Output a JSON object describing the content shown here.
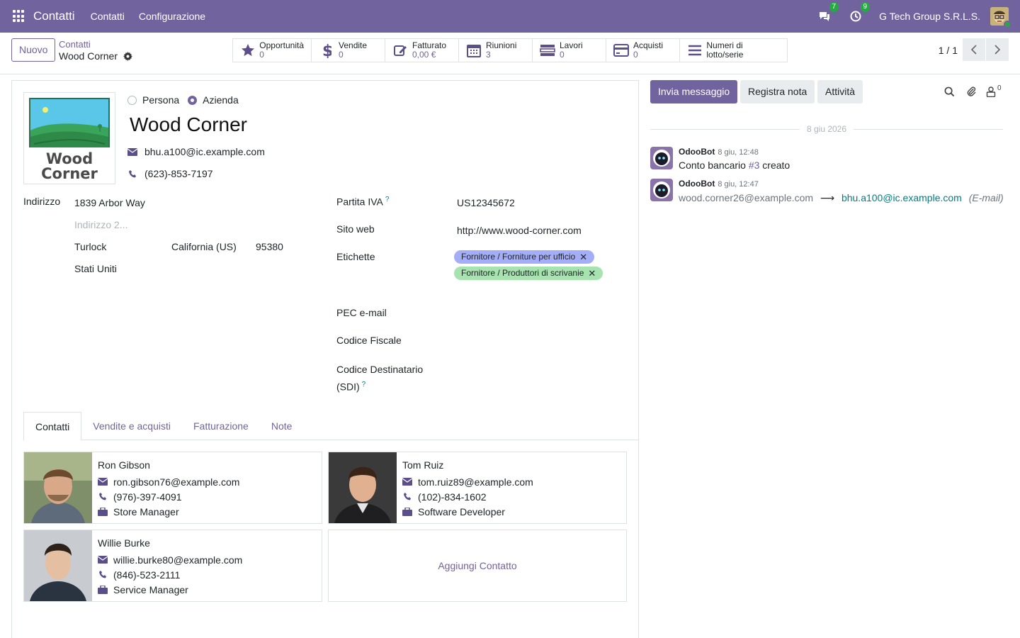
{
  "navbar": {
    "app_name": "Contatti",
    "menus": [
      "Contatti",
      "Configurazione"
    ],
    "messages_count": "7",
    "activities_count": "9",
    "company": "G Tech Group S.R.L.S."
  },
  "control": {
    "new_button": "Nuovo",
    "breadcrumb_parent": "Contatti",
    "breadcrumb_current": "Wood Corner",
    "smart_buttons": [
      {
        "label": "Opportunità",
        "value": "0",
        "icon": "star-icon"
      },
      {
        "label": "Vendite",
        "value": "0",
        "icon": "dollar-icon"
      },
      {
        "label": "Fatturato",
        "value": "0,00 €",
        "icon": "pencil-square-icon"
      },
      {
        "label": "Riunioni",
        "value": "3",
        "icon": "calendar-icon"
      },
      {
        "label": "Lavori",
        "value": "0",
        "icon": "tasks-icon"
      },
      {
        "label": "Acquisti",
        "value": "0",
        "icon": "credit-card-icon"
      },
      {
        "label": "Numeri di lotto/serie",
        "value": "",
        "icon": "bars-icon"
      }
    ],
    "pager": "1 / 1"
  },
  "form": {
    "logo_text_1": "Wood",
    "logo_text_2": "Corner",
    "type_person": "Persona",
    "type_company": "Azienda",
    "name": "Wood Corner",
    "email": "bhu.a100@ic.example.com",
    "phone": "(623)-853-7197",
    "address_label": "Indirizzo",
    "street": "1839 Arbor Way",
    "street2_placeholder": "Indirizzo 2...",
    "city": "Turlock",
    "state": "California (US)",
    "zip": "95380",
    "country": "Stati Uniti",
    "vat_label": "Partita IVA",
    "vat": "US12345672",
    "website_label": "Sito web",
    "website": "http://www.wood-corner.com",
    "tags_label": "Etichette",
    "tags": [
      {
        "label": "Fornitore / Forniture per ufficio",
        "color": "#a3aef7"
      },
      {
        "label": "Fornitore / Produttori di scrivanie",
        "color": "#a6e3ae"
      }
    ],
    "pec_label": "PEC e-mail",
    "fiscal_code_label": "Codice Fiscale",
    "sdi_label_1": "Codice Destinatario",
    "sdi_label_2": "(SDI)",
    "help_mark": "?"
  },
  "tabs": [
    "Contatti",
    "Vendite e acquisti",
    "Fatturazione",
    "Note"
  ],
  "contacts": [
    {
      "name": "Ron Gibson",
      "email": "ron.gibson76@example.com",
      "phone": "(976)-397-4091",
      "job": "Store Manager"
    },
    {
      "name": "Tom Ruiz",
      "email": "tom.ruiz89@example.com",
      "phone": "(102)-834-1602",
      "job": "Software Developer"
    },
    {
      "name": "Willie Burke",
      "email": "willie.burke80@example.com",
      "phone": "(846)-523-2111",
      "job": "Service Manager"
    }
  ],
  "add_contact": "Aggiungi Contatto",
  "chatter": {
    "send_message": "Invia messaggio",
    "log_note": "Registra nota",
    "activities": "Attività",
    "followers_count": "0",
    "date_separator": "8 giu 2026",
    "messages": [
      {
        "author": "OdooBot",
        "time": "8 giu, 12:48",
        "text_before": "Conto bancario ",
        "link": "#3",
        "text_after": " creato"
      },
      {
        "author": "OdooBot",
        "time": "8 giu, 12:47",
        "old_value": "wood.corner26@example.com",
        "new_value": "bhu.a100@ic.example.com",
        "field": "(E-mail)"
      }
    ]
  },
  "colors": {
    "primary": "#71639e",
    "link": "#017e84",
    "badge": "#28a745"
  }
}
